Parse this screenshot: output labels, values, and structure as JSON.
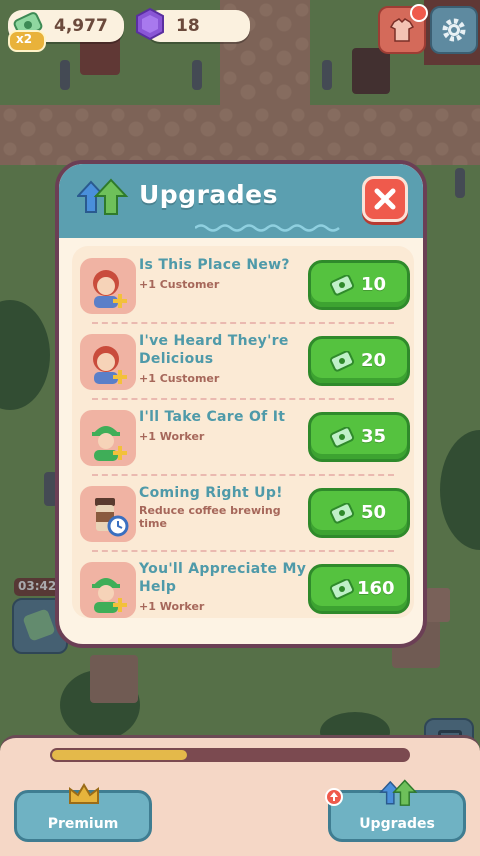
{
  "hud": {
    "cash_amount": "4,977",
    "cash_multiplier": "x2",
    "gem_amount": "18"
  },
  "timer": {
    "label": "03:42"
  },
  "modal": {
    "title": "Upgrades",
    "close_icon": "close-x-icon",
    "header_icon": "upgrade-arrows-icon"
  },
  "upgrades": [
    {
      "title": "Is This Place New?",
      "subtitle": "+1 Customer",
      "price": "10",
      "icon": "customer-plus-icon"
    },
    {
      "title": "I've Heard They're Delicious",
      "subtitle": "+1 Customer",
      "price": "20",
      "icon": "customer-plus-icon"
    },
    {
      "title": "I'll Take Care Of It",
      "subtitle": "+1 Worker",
      "price": "35",
      "icon": "worker-plus-icon"
    },
    {
      "title": "Coming Right Up!",
      "subtitle": "Reduce coffee brewing time",
      "price": "50",
      "icon": "coffee-timer-icon"
    },
    {
      "title": "You'll Appreciate My Help",
      "subtitle": "+1 Worker",
      "price": "160",
      "icon": "worker-plus-icon"
    }
  ],
  "bottom": {
    "progress_fraction": 0.38,
    "premium_label": "Premium",
    "upgrades_label": "Upgrades"
  },
  "colors": {
    "header": "#5b9fb0",
    "buy_button": "#55c23f",
    "close_button": "#ef5a4c",
    "title_text": "#4f9aa9",
    "sub_text": "#a6675a"
  }
}
